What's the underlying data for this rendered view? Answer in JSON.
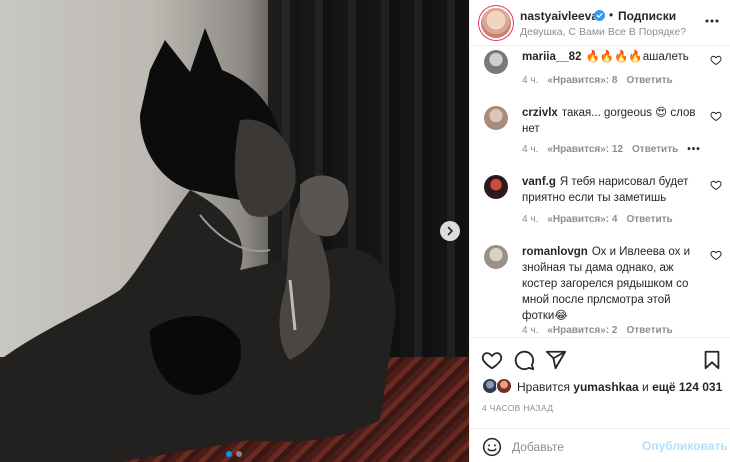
{
  "post": {
    "username": "nastyaivleeva",
    "separator": "•",
    "follow_label": "Подписки",
    "location": "Девушка, С Вами Все В Порядке?"
  },
  "comments": [
    {
      "username": "mariia__82",
      "text": "🔥🔥🔥🔥ашалеть",
      "time": "4 ч.",
      "likes": "«Нравится»: 8",
      "reply": "Ответить"
    },
    {
      "username": "crzivlx",
      "text": "такая... gorgeous 😍 слов нет",
      "time": "4 ч.",
      "likes": "«Нравится»: 12",
      "reply": "Ответить",
      "more": "•••"
    },
    {
      "username": "vanf.g",
      "text": "Я тебя нарисовал будет приятно если ты заметишь",
      "time": "4 ч.",
      "likes": "«Нравится»: 4",
      "reply": "Ответить"
    },
    {
      "username": "romanlovgn",
      "text": "Ох и Ивлеева ох и знойная ты дама однако, аж костер загорелся рядышком со мной после прлсмотра этой фотки😂",
      "time": "4 ч.",
      "likes": "«Нравится»: 2",
      "reply": "Ответить"
    }
  ],
  "likes": {
    "prefix": "Нравится",
    "user": "yumashkaa",
    "middle": "и",
    "count": "ещё 124 031"
  },
  "timestamp": "4 ЧАСОВ НАЗАД",
  "composer": {
    "placeholder": "Добавьте",
    "publish_label": "Опубликовать"
  },
  "icons": {
    "like": "heart-icon",
    "comment": "comment-icon",
    "share": "send-icon",
    "save": "bookmark-icon",
    "emoji": "emoji-icon",
    "more": "more-icon",
    "carousel_next": "chevron-right-icon"
  },
  "colors": {
    "accent": "#0095f6",
    "publish_disabled": "#b2dffc",
    "verified": "#3897f0",
    "secondary_text": "#8e8e8e"
  }
}
